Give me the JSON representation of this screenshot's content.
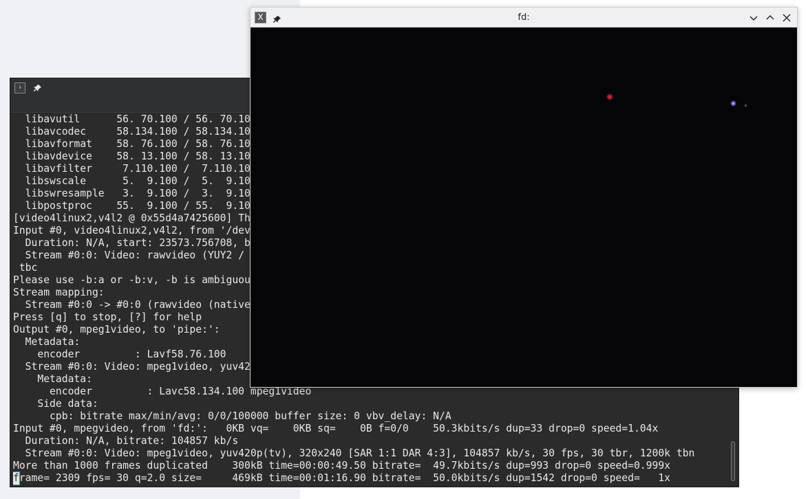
{
  "terminal": {
    "app_icon": "terminal-prompt-icon",
    "lines": [
      "  libavutil      56. 70.100 / 56. 70.10",
      "  libavcodec     58.134.100 / 58.134.10",
      "  libavformat    58. 76.100 / 58. 76.10",
      "  libavdevice    58. 13.100 / 58. 13.10",
      "  libavfilter     7.110.100 /  7.110.10",
      "  libswscale      5.  9.100 /  5.  9.10",
      "  libswresample   3.  9.100 /  3.  9.10",
      "  libpostproc    55.  9.100 / 55.  9.10",
      "[video4linux2,v4l2 @ 0x55d4a7425600] Th",
      "Input #0, video4linux2,v4l2, from '/dev",
      "  Duration: N/A, start: 23573.756708, b",
      "  Stream #0:0: Video: rawvideo (YUY2 /",
      " tbc",
      "Please use -b:a or -b:v, -b is ambiguou",
      "Stream mapping:",
      "  Stream #0:0 -> #0:0 (rawvideo (native",
      "Press [q] to stop, [?] for help",
      "Output #0, mpeg1video, to 'pipe:':",
      "  Metadata:",
      "    encoder         : Lavf58.76.100",
      "  Stream #0:0: Video: mpeg1video, yuv42",
      "    Metadata:",
      "      encoder         : Lavc58.134.100 mpeg1video",
      "    Side data:",
      "      cpb: bitrate max/min/avg: 0/0/100000 buffer size: 0 vbv_delay: N/A",
      "Input #0, mpegvideo, from 'fd:':   0KB vq=    0KB sq=    0B f=0/0    50.3kbits/s dup=33 drop=0 speed=1.04x",
      "  Duration: N/A, bitrate: 104857 kb/s",
      "  Stream #0:0: Video: mpeg1video, yuv420p(tv), 320x240 [SAR 1:1 DAR 4:3], 104857 kb/s, 30 fps, 30 tbr, 1200k tbn",
      "More than 1000 frames duplicated    300kB time=00:00:49.50 bitrate=  49.7kbits/s dup=993 drop=0 speed=0.999x"
    ],
    "last_line_cursor_char": "f",
    "last_line_rest": "rame= 2309 fps= 30 q=2.0 size=     469kB time=00:01:16.90 bitrate=  50.0kbits/s dup=1542 drop=0 speed=   1x"
  },
  "video_window": {
    "app_icon": "x-window-icon",
    "app_icon_glyph": "X",
    "title": "fd:"
  }
}
